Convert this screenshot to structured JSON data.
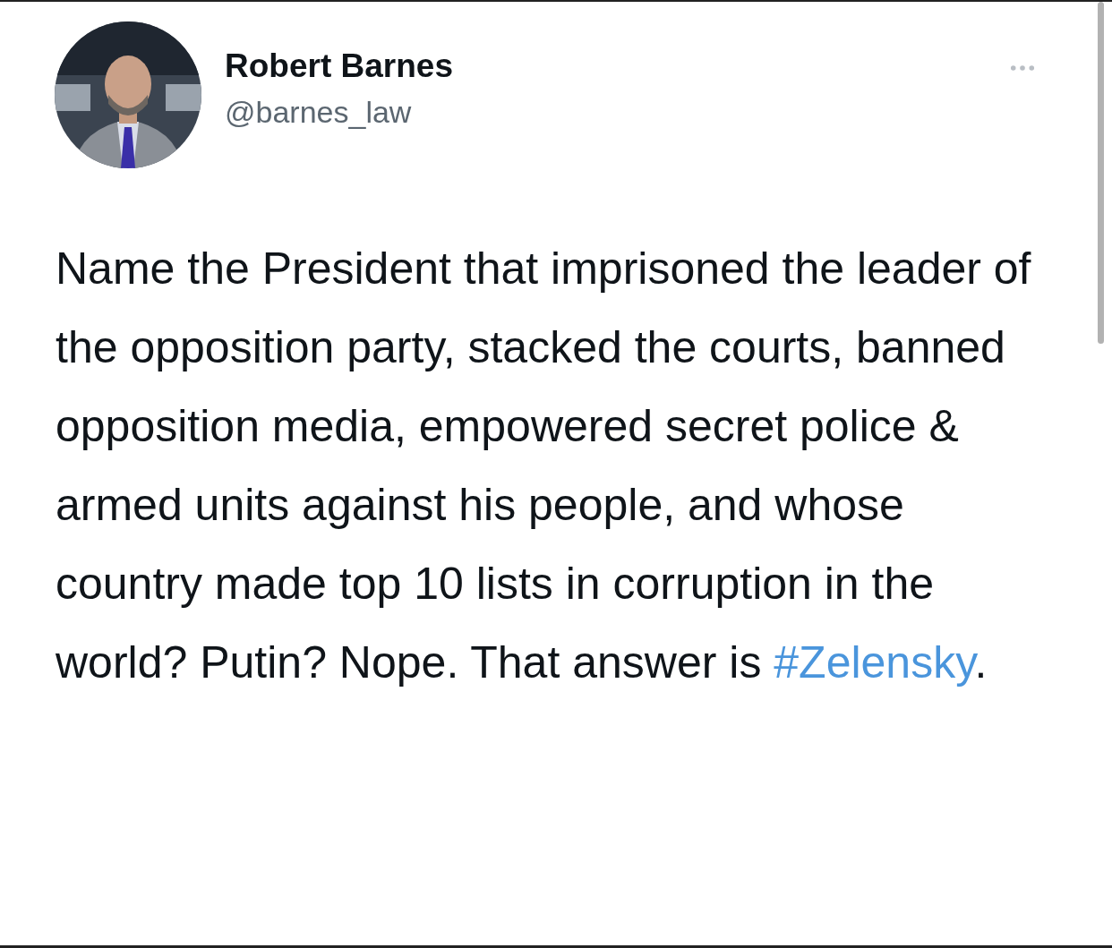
{
  "author": {
    "name": "Robert Barnes",
    "handle": "@barnes_law"
  },
  "tweet": {
    "text": "Name the President that imprisoned the leader of the opposition party, stacked the courts, banned opposition media, empowered secret police & armed units against his people, and whose country made top 10 lists in corruption in the world? Putin? Nope. That answer is ",
    "hashtag": "#Zelensky",
    "after": "."
  }
}
